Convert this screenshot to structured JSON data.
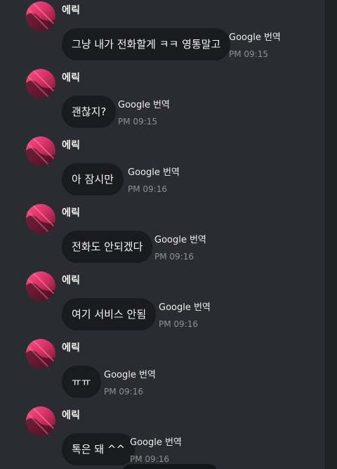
{
  "chat": {
    "messages": [
      {
        "sender": "에릭",
        "text": "그냥 내가 전화할게 ㅋㅋ 영통말고",
        "translate_label": "Google 번역",
        "time": "PM 09:15"
      },
      {
        "sender": "에릭",
        "text": "괜찮지?",
        "translate_label": "Google 번역",
        "time": "PM 09:15"
      },
      {
        "sender": "에릭",
        "text": "아 잠시만",
        "translate_label": "Google 번역",
        "time": "PM 09:16"
      },
      {
        "sender": "에릭",
        "text": "전화도 안되겠다",
        "translate_label": "Google 번역",
        "time": "PM 09:16"
      },
      {
        "sender": "에릭",
        "text": "여기 서비스 안됨",
        "translate_label": "Google 번역",
        "time": "PM 09:16"
      },
      {
        "sender": "에릭",
        "text": "ㅠㅠ",
        "translate_label": "Google 번역",
        "time": "PM 09:16"
      },
      {
        "sender": "에릭",
        "text": "톡은 돼 ^^",
        "translate_label": "Google 번역",
        "time": "PM 09:16"
      }
    ]
  },
  "colors": {
    "background": "#2b2c31",
    "bubble": "#1a1b1e",
    "avatar_accent": "#e23a72",
    "timestamp": "#8f9197"
  }
}
